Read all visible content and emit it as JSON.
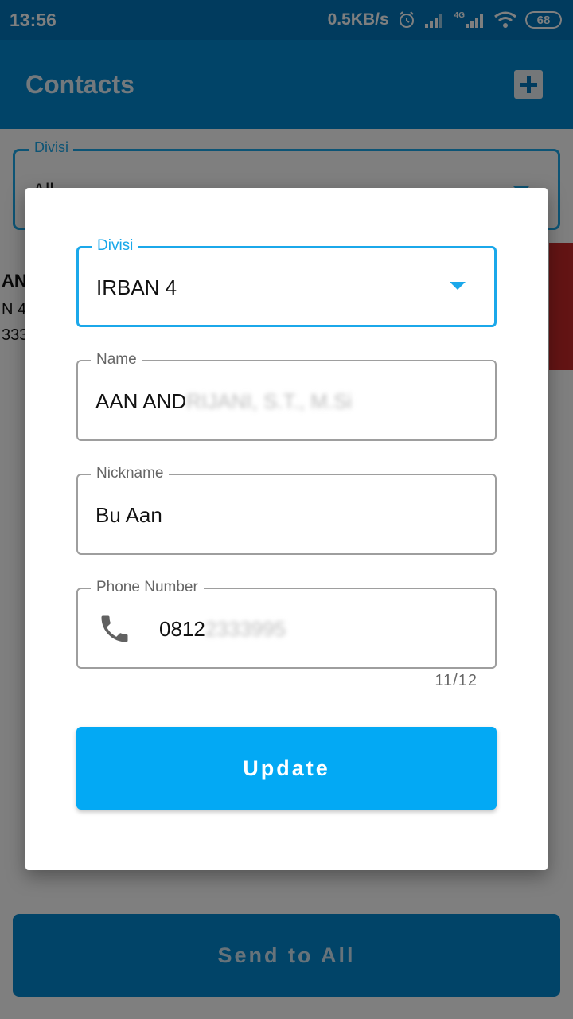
{
  "status_bar": {
    "time": "13:56",
    "speed": "0.5KB/s",
    "network_label": "4G",
    "battery": "68"
  },
  "app_bar": {
    "title": "Contacts",
    "add_icon": "plus-box-icon"
  },
  "filter": {
    "label": "Divisi",
    "value": "All"
  },
  "contact": {
    "name_partial": "AN",
    "divisi_partial": "N 4",
    "phone_partial": "333"
  },
  "send_all_label": "Send to All",
  "dialog": {
    "divisi": {
      "label": "Divisi",
      "value": "IRBAN 4"
    },
    "name": {
      "label": "Name",
      "value_visible": "AAN AND",
      "value_blurred": "RIJANI, S.T., M.Si"
    },
    "nickname": {
      "label": "Nickname",
      "value": "Bu Aan"
    },
    "phone": {
      "label": "Phone Number",
      "value_visible": "0812",
      "value_blurred": "2333995",
      "icon": "phone-icon",
      "counter": "11/12"
    },
    "update_label": "Update"
  },
  "colors": {
    "primary": "#0288d1",
    "accent": "#03a9f4",
    "focus": "#1ba8ea",
    "danger": "#c62828"
  }
}
